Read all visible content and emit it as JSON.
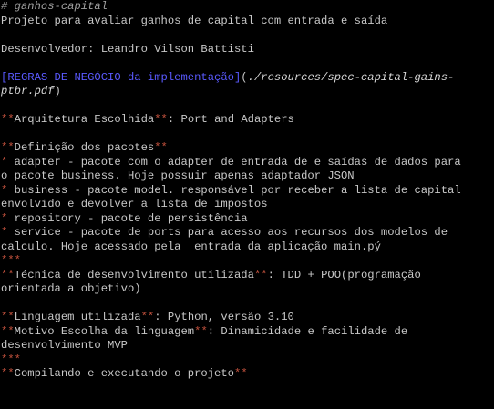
{
  "header": {
    "title_hash": "# ",
    "title": "ganhos-capital",
    "description": "Projeto para avaliar ganhos de capital com entrada e saída"
  },
  "developer": "Desenvolvedor: Leandro Vilson Battisti",
  "rules_link": {
    "label": "[REGRAS DE NEGÓCIO da implementação]",
    "open_paren": "(",
    "path_part1": "./resources/spec-capital-gains-",
    "path_part2": "ptbr.pdf",
    "close_paren": ")"
  },
  "architecture": {
    "open": "**",
    "label": "Arquitetura Escolhida",
    "close": "**",
    "value": ": Port and Adapters"
  },
  "packages": {
    "open": "**",
    "label": "Definição dos pacotes",
    "close": "**",
    "items": [
      {
        "lines": [
          "adapter - pacote com o adapter de entrada de e saídas de dados para",
          "o pacote business. Hoje possuir apenas adaptador JSON"
        ]
      },
      {
        "lines": [
          "business - pacote model. responsável por receber a lista de capital",
          "envolvido e devolver a lista de impostos"
        ]
      },
      {
        "lines": [
          "repository - pacote de persistência"
        ]
      },
      {
        "lines": [
          "service - pacote de ports para acesso aos recursos dos modelos de",
          "calculo. Hoje acessado pela  entrada da aplicação main.pý"
        ]
      }
    ],
    "bullet": "* "
  },
  "hr": "***",
  "technique": {
    "open": "**",
    "label": "Técnica de desenvolvimento utilizada",
    "close": "**",
    "value": ": TDD + POO(programação",
    "value_cont": "orientada a objetivo)"
  },
  "language": {
    "open": "**",
    "label": "Linguagem utilizada",
    "close": "**",
    "value": ": Python, versão 3.10"
  },
  "reason": {
    "open": "**",
    "label": "Motivo Escolha da linguagem",
    "close": "**",
    "value": ": Dinamicidade e facilidade de",
    "value_cont": "desenvolvimento MVP"
  },
  "compile": {
    "open": "**",
    "label": "Compilando e executando o projeto",
    "close": "**"
  },
  "colors": {
    "background": "#000000",
    "text": "#c0c0c0",
    "markup": "#c0503c",
    "link": "#5a5aff"
  }
}
